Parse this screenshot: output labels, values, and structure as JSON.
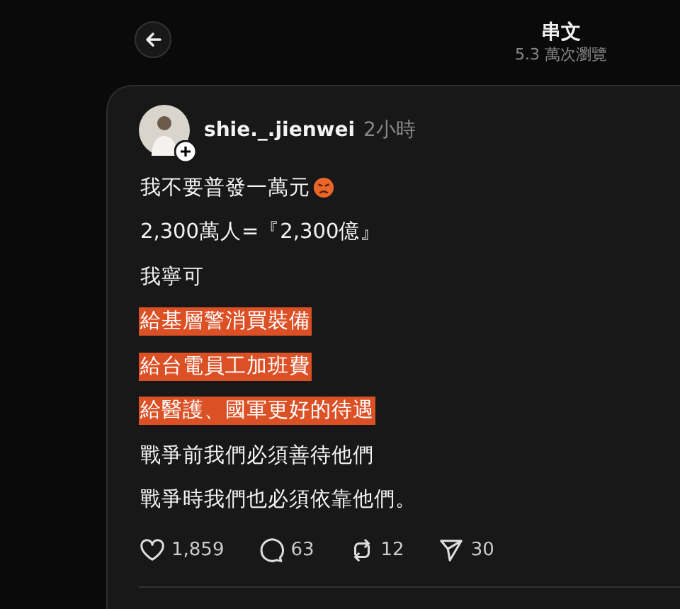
{
  "header": {
    "title": "串文",
    "views": "5.3 萬次瀏覽"
  },
  "post": {
    "username": "shie._.jienwei",
    "time": "2小時",
    "lines": [
      {
        "text": "我不要普發一萬元",
        "kind": "with_emoji",
        "highlighted": false
      },
      {
        "text": "2,300萬人=『2,300億』",
        "highlighted": false
      },
      {
        "text": "我寧可",
        "highlighted": false
      },
      {
        "text": "給基層警消買裝備",
        "highlighted": true
      },
      {
        "text": "給台電員工加班費",
        "highlighted": true
      },
      {
        "text": "給醫護、國軍更好的待遇",
        "highlighted": true
      },
      {
        "text": "戰爭前我們必須善待他們",
        "highlighted": false
      },
      {
        "text": "戰爭時我們也必須依靠他們。",
        "highlighted": false
      }
    ],
    "actions": [
      {
        "kind": "like",
        "count": "1,859"
      },
      {
        "kind": "comment",
        "count": "63"
      },
      {
        "kind": "repost",
        "count": "12"
      },
      {
        "kind": "share",
        "count": "30"
      }
    ]
  }
}
